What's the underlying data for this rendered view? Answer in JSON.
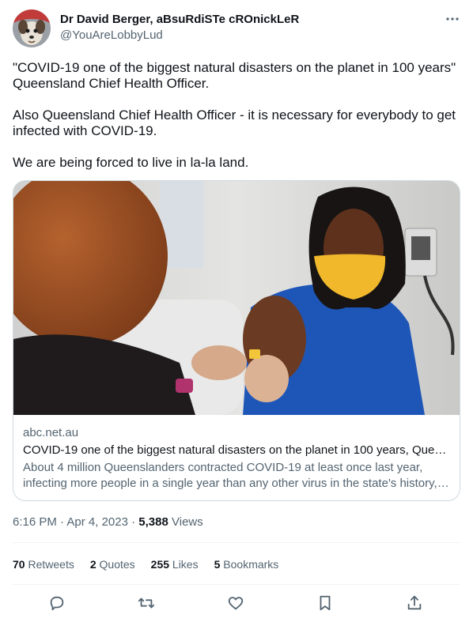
{
  "user": {
    "display_name": "Dr David Berger, aBsuRdiSTe cROnickLeR",
    "handle": "@YouAreLobbyLud",
    "avatar_icon": "dog-avatar"
  },
  "tweet": {
    "paragraphs": [
      "\"COVID-19 one of the biggest natural disasters on the planet in 100 years\"\nQueensland Chief Health Officer.",
      "Also Queensland Chief Health Officer - it is necessary for everybody to get infected with COVID-19.",
      "We are being forced to live in la-la land."
    ]
  },
  "card": {
    "domain": "abc.net.au",
    "title": "COVID-19 one of the biggest natural disasters on the planet in 100 years, Queen...",
    "description": "About 4 million Queenslanders contracted COVID-19 at least once last year, infecting more people in a single year than any other virus in the state's history, ..."
  },
  "meta": {
    "time": "6:16 PM",
    "date": "Apr 4, 2023",
    "views_count": "5,388",
    "views_label": "Views",
    "sep": "·"
  },
  "stats": [
    {
      "count": "70",
      "label": "Retweets"
    },
    {
      "count": "2",
      "label": "Quotes"
    },
    {
      "count": "255",
      "label": "Likes"
    },
    {
      "count": "5",
      "label": "Bookmarks"
    }
  ],
  "actions": [
    "reply-icon",
    "retweet-icon",
    "like-icon",
    "bookmark-icon",
    "share-icon"
  ],
  "colors": {
    "text": "#0f1419",
    "muted": "#536471",
    "border": "#cfd9de",
    "divider": "#eff3f4"
  }
}
